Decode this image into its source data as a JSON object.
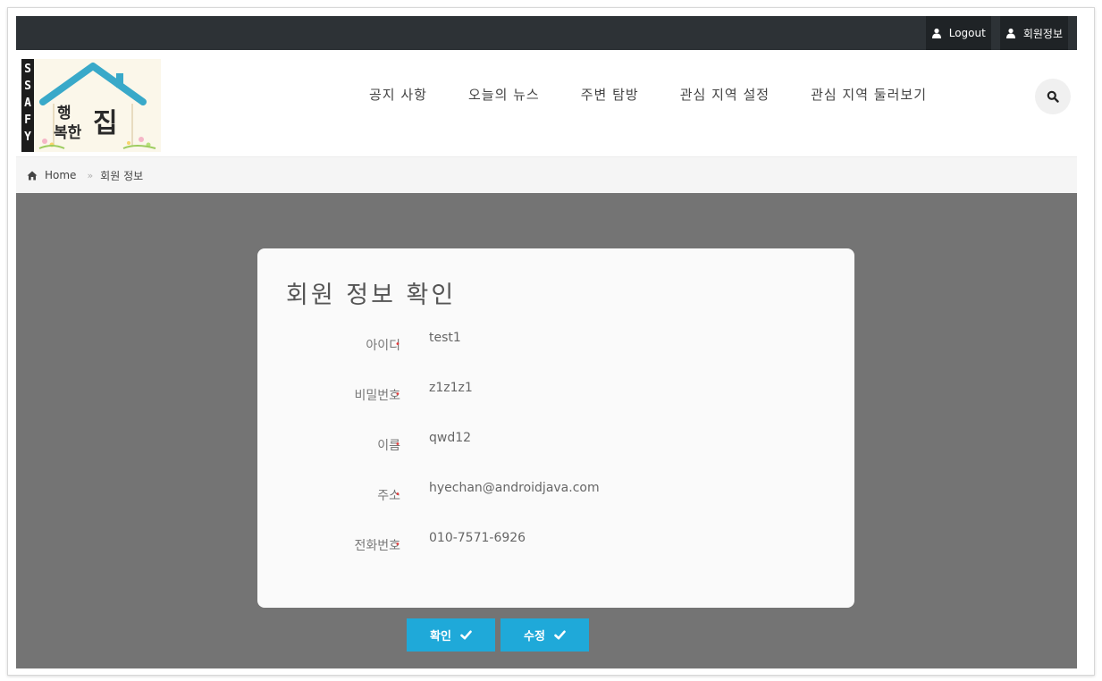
{
  "topbar": {
    "logout_label": "Logout",
    "member_info_label": "회원정보"
  },
  "logo": {
    "brand_letters": [
      "S",
      "S",
      "A",
      "F",
      "Y"
    ],
    "house_text_line1": "행",
    "house_text_line2": "복한",
    "house_text_big": "집"
  },
  "nav": {
    "items": [
      {
        "label": "공지 사항"
      },
      {
        "label": "오늘의 뉴스"
      },
      {
        "label": "주변 탐방"
      },
      {
        "label": "관심 지역 설정"
      },
      {
        "label": "관심 지역 둘러보기"
      }
    ],
    "search_icon": "search-icon"
  },
  "breadcrumb": {
    "home_label": "Home",
    "separator": "»",
    "current_label": "회원 정보"
  },
  "card": {
    "title": "회원 정보 확인",
    "required_mark": "•",
    "fields": [
      {
        "label": "아이디",
        "value": "test1"
      },
      {
        "label": "비밀번호",
        "value": "z1z1z1"
      },
      {
        "label": "이름",
        "value": "qwd12"
      },
      {
        "label": "주소",
        "value": "hyechan@androidjava.com"
      },
      {
        "label": "전화번호",
        "value": "010-7571-6926"
      }
    ]
  },
  "buttons": {
    "confirm_label": "확인",
    "edit_label": "수정"
  },
  "colors": {
    "topbar": "#2d3236",
    "accent": "#1fa9d9",
    "gray_area": "#747474",
    "required": "#e23c3c"
  }
}
